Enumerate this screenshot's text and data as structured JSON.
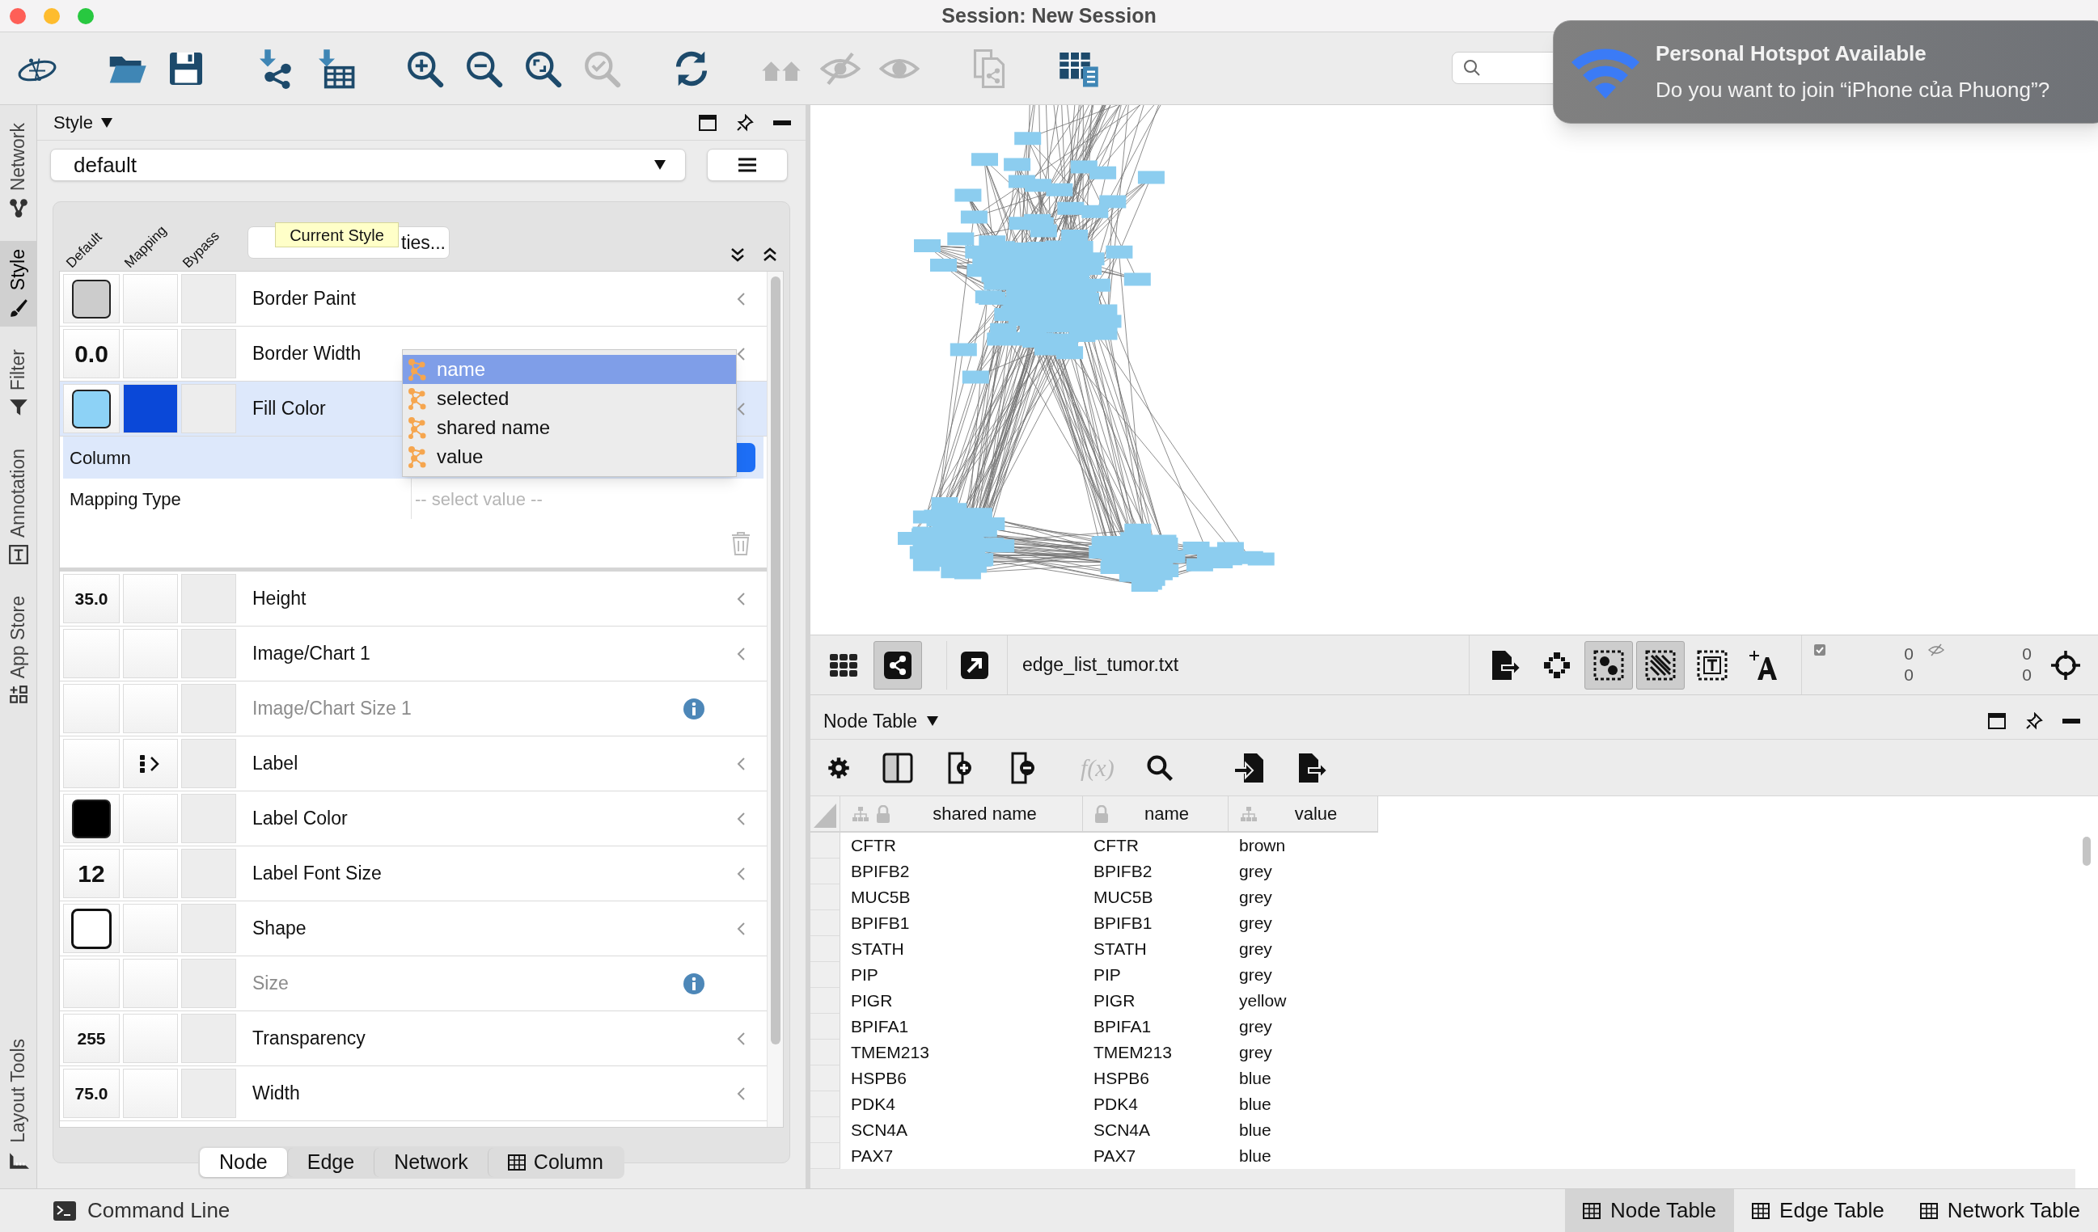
{
  "window": {
    "title": "Session: New Session"
  },
  "toolbar": [
    [
      {
        "kind": "logo",
        "disabled": false
      }
    ],
    [
      {
        "kind": "open",
        "disabled": false
      },
      {
        "kind": "save",
        "disabled": false
      }
    ],
    [
      {
        "kind": "import_network",
        "disabled": false
      },
      {
        "kind": "import_table",
        "disabled": false
      }
    ],
    [
      {
        "kind": "zoom_in",
        "disabled": false
      },
      {
        "kind": "zoom_out",
        "disabled": false
      },
      {
        "kind": "zoom_fit",
        "disabled": false
      },
      {
        "kind": "zoom_selected",
        "disabled": true
      }
    ],
    [
      {
        "kind": "refresh",
        "disabled": false
      }
    ],
    [
      {
        "kind": "home",
        "disabled": true
      },
      {
        "kind": "hide",
        "disabled": true
      },
      {
        "kind": "show",
        "disabled": true
      }
    ],
    [
      {
        "kind": "document",
        "disabled": true
      }
    ],
    [
      {
        "kind": "table",
        "disabled": false
      }
    ]
  ],
  "notification": {
    "title": "Personal Hotspot Available",
    "message": "Do you want to join “iPhone của Phuong”?"
  },
  "side_tabs": [
    {
      "kind": "network",
      "label": "Network",
      "selected": false
    },
    {
      "kind": "style",
      "label": "Style",
      "selected": true
    },
    {
      "kind": "filter",
      "label": "Filter",
      "selected": false
    },
    {
      "kind": "annotation",
      "label": "Annotation",
      "selected": false
    },
    {
      "kind": "app_store",
      "label": "App Store",
      "selected": false
    },
    {
      "kind": "layout_tools",
      "label": "Layout Tools",
      "selected": false
    }
  ],
  "style_panel": {
    "title": "Style",
    "style_name": "default",
    "column_headers": [
      "Default",
      "Mapping",
      "Bypass"
    ],
    "more_button": "ties...",
    "tooltip": "Current Style",
    "properties": [
      {
        "name": "Border Paint",
        "default": {
          "kind": "color",
          "color": "#cccccc"
        },
        "disabled": false,
        "expanded": false
      },
      {
        "name": "Border Width",
        "default": {
          "kind": "big_number",
          "text": "0.0"
        },
        "disabled": false,
        "expanded": false
      },
      {
        "name": "Fill Color",
        "default": {
          "kind": "color",
          "color": "#8dd2f6"
        },
        "mapping": {
          "kind": "color",
          "color": "#0a48d8"
        },
        "disabled": false,
        "expanded": true
      },
      {
        "name": "Height",
        "default": {
          "kind": "number",
          "text": "35.0"
        },
        "disabled": false,
        "expanded": false
      },
      {
        "name": "Image/Chart 1",
        "disabled": false,
        "expanded": false
      },
      {
        "name": "Image/Chart Size 1",
        "disabled": true,
        "expanded": false
      },
      {
        "name": "Label",
        "mapping": {
          "kind": "passthrough"
        },
        "disabled": false,
        "expanded": false
      },
      {
        "name": "Label Color",
        "default": {
          "kind": "color",
          "color": "#000000"
        },
        "disabled": false,
        "expanded": false
      },
      {
        "name": "Label Font Size",
        "default": {
          "kind": "big_number",
          "text": "12"
        },
        "disabled": false,
        "expanded": false
      },
      {
        "name": "Shape",
        "default": {
          "kind": "shape"
        },
        "disabled": false,
        "expanded": false
      },
      {
        "name": "Size",
        "disabled": true,
        "expanded": false
      },
      {
        "name": "Transparency",
        "default": {
          "kind": "number",
          "text": "255"
        },
        "disabled": false,
        "expanded": false
      },
      {
        "name": "Width",
        "default": {
          "kind": "number",
          "text": "75.0"
        },
        "disabled": false,
        "expanded": false
      }
    ],
    "mapping_editor": {
      "column_label": "Column",
      "mapping_type_label": "Mapping Type",
      "mapping_type_placeholder": "-- select value --"
    },
    "column_dropdown": [
      {
        "label": "name",
        "selected": true
      },
      {
        "label": "selected",
        "selected": false
      },
      {
        "label": "shared name",
        "selected": false
      },
      {
        "label": "value",
        "selected": false
      }
    ],
    "tabs": [
      {
        "kind": "plain",
        "label": "Node",
        "selected": true
      },
      {
        "kind": "plain",
        "label": "Edge",
        "selected": false
      },
      {
        "kind": "plain",
        "label": "Network",
        "selected": false
      },
      {
        "kind": "table",
        "label": "Column",
        "selected": false
      }
    ]
  },
  "network_view": {
    "toolbar_left": [
      {
        "kind": "grid",
        "selected": false
      },
      {
        "kind": "share",
        "selected": true
      },
      {
        "kind": "open_external",
        "selected": false
      }
    ],
    "network_name": "edge_list_tumor.txt",
    "toolbar_right": [
      {
        "kind": "export",
        "selected": false
      },
      {
        "kind": "layout",
        "selected": false
      },
      {
        "kind": "select_nodes",
        "selected": true
      },
      {
        "kind": "select_edges",
        "selected": true
      },
      {
        "kind": "select_annotations",
        "selected": false
      },
      {
        "kind": "text_move",
        "selected": false
      }
    ],
    "selected_counts": [
      "0",
      "0"
    ],
    "hidden_counts": [
      "0",
      "0"
    ]
  },
  "node_table": {
    "title": "Node Table",
    "toolbar": [
      {
        "kind": "settings",
        "disabled": false
      },
      {
        "kind": "columns",
        "disabled": false
      },
      {
        "kind": "add",
        "disabled": false
      },
      {
        "kind": "delete",
        "disabled": false
      },
      {
        "kind": "formula",
        "label": "f(x)",
        "disabled": true
      },
      {
        "kind": "search",
        "disabled": false
      },
      {
        "kind": "import",
        "disabled": false
      },
      {
        "kind": "export",
        "disabled": false
      }
    ],
    "columns": [
      {
        "label": "shared name",
        "shared": true,
        "locked": true
      },
      {
        "label": "name",
        "shared": false,
        "locked": true
      },
      {
        "label": "value",
        "shared": true,
        "locked": false
      }
    ],
    "rows": [
      [
        "CFTR",
        "CFTR",
        "brown"
      ],
      [
        "BPIFB2",
        "BPIFB2",
        "grey"
      ],
      [
        "MUC5B",
        "MUC5B",
        "grey"
      ],
      [
        "BPIFB1",
        "BPIFB1",
        "grey"
      ],
      [
        "STATH",
        "STATH",
        "grey"
      ],
      [
        "PIP",
        "PIP",
        "grey"
      ],
      [
        "PIGR",
        "PIGR",
        "yellow"
      ],
      [
        "BPIFA1",
        "BPIFA1",
        "grey"
      ],
      [
        "TMEM213",
        "TMEM213",
        "grey"
      ],
      [
        "HSPB6",
        "HSPB6",
        "blue"
      ],
      [
        "PDK4",
        "PDK4",
        "blue"
      ],
      [
        "SCN4A",
        "SCN4A",
        "blue"
      ],
      [
        "PAX7",
        "PAX7",
        "blue"
      ]
    ]
  },
  "status_bar": {
    "command_line": "Command Line",
    "tabs": [
      {
        "label": "Node Table",
        "selected": true
      },
      {
        "label": "Edge Table",
        "selected": false
      },
      {
        "label": "Network Table",
        "selected": false
      }
    ]
  }
}
